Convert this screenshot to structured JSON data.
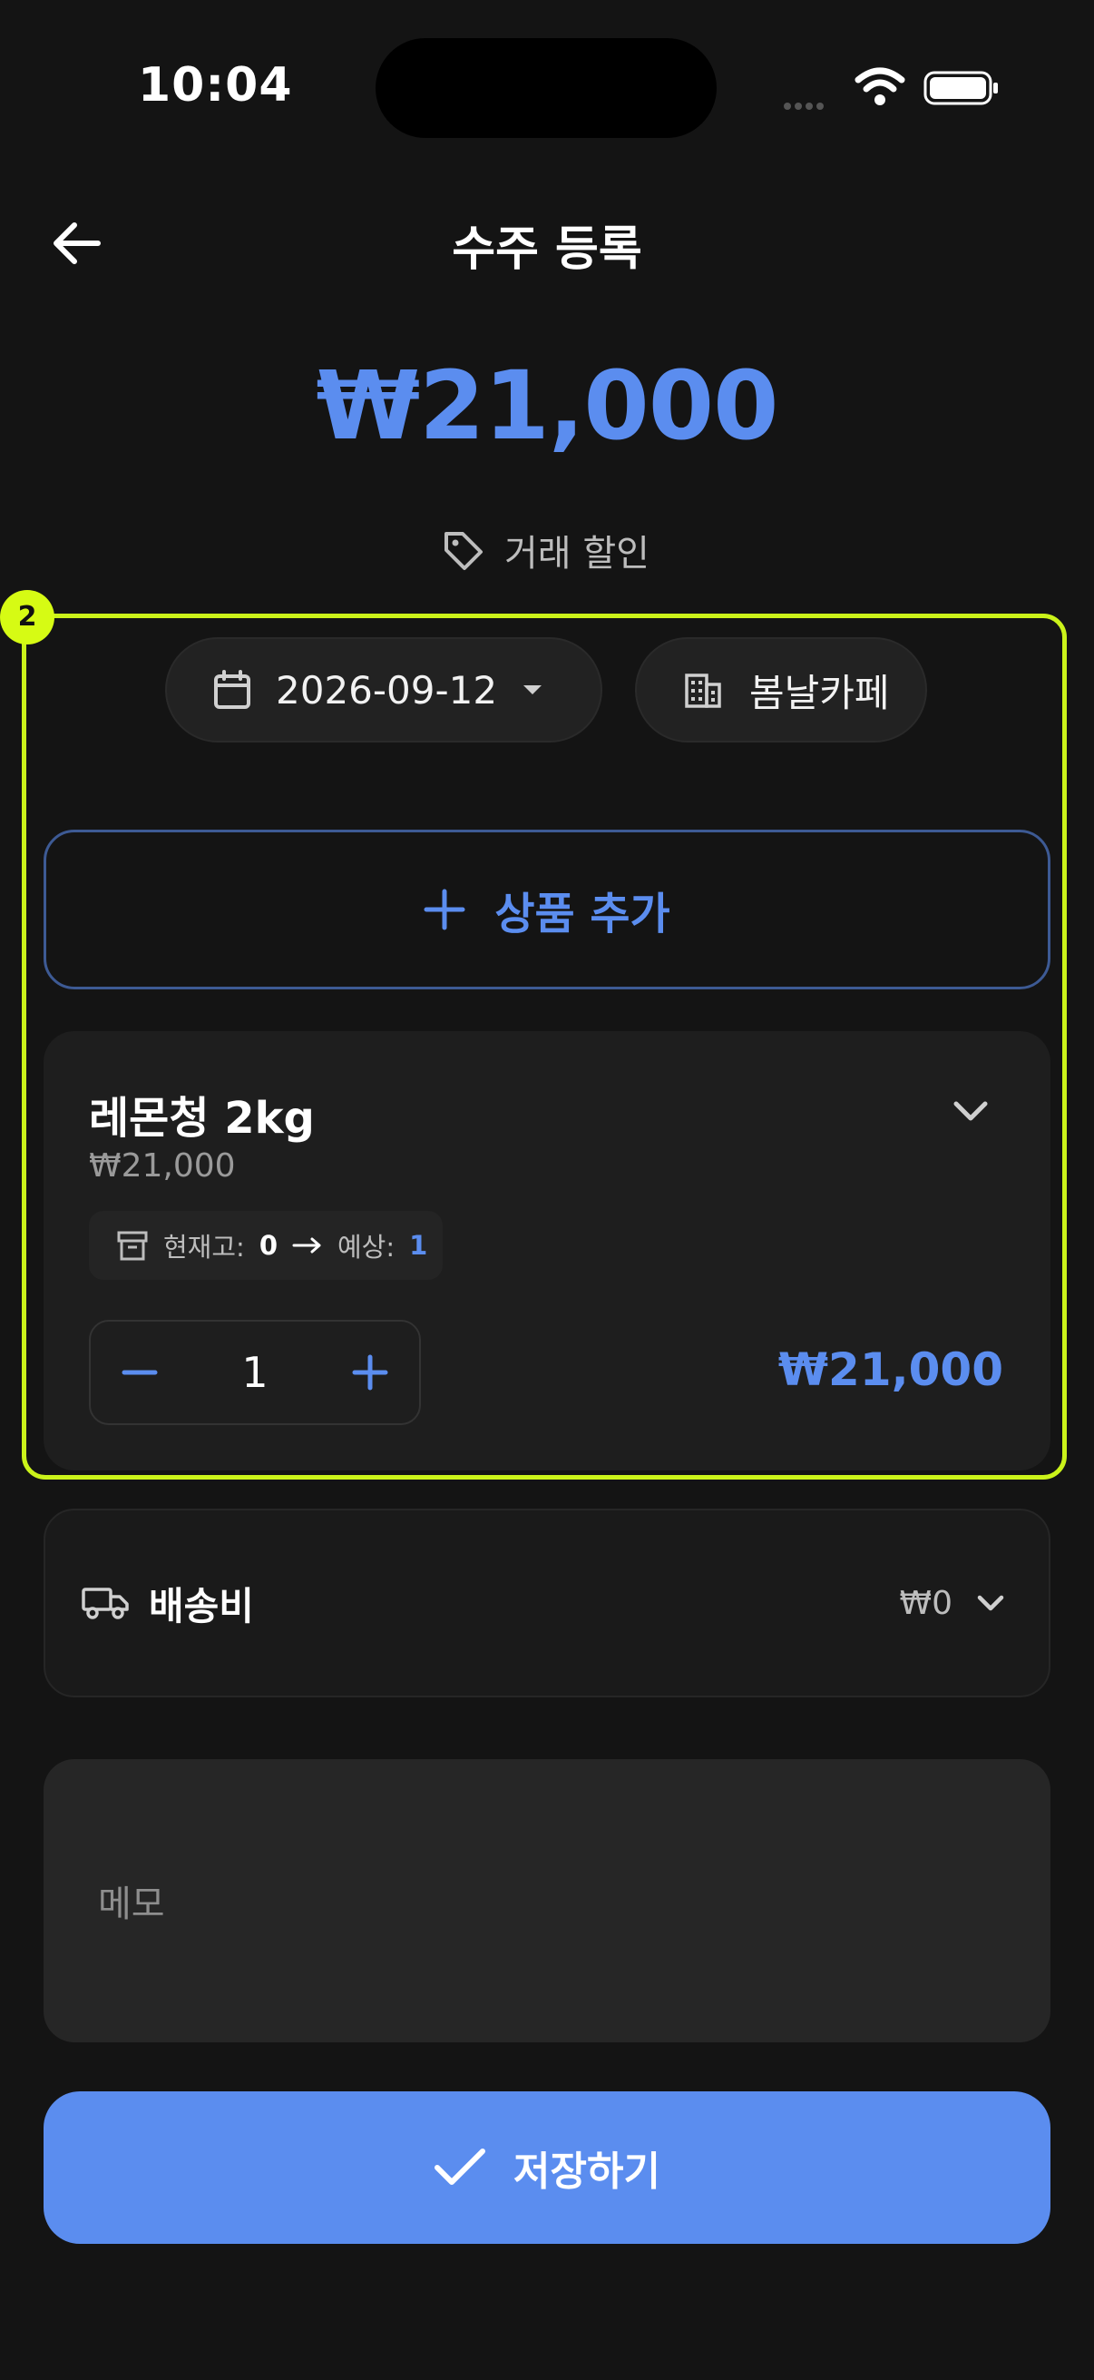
{
  "status_bar": {
    "time": "10:04"
  },
  "header": {
    "title": "수주 등록"
  },
  "summary": {
    "total": "₩21,000",
    "discount_label": "거래 할인"
  },
  "annotation": {
    "badge": "2"
  },
  "filters": {
    "date": "2026-09-12",
    "store": "봄날카페"
  },
  "add_product": {
    "label": "상품 추가"
  },
  "item": {
    "name": "레몬청 2kg",
    "unit_price": "₩21,000",
    "stock_label": "현재고:",
    "stock_value": "0",
    "expected_label": "예상:",
    "expected_value": "1",
    "quantity": "1",
    "line_total": "₩21,000"
  },
  "shipping": {
    "label": "배송비",
    "value": "₩0"
  },
  "memo": {
    "placeholder": "메모"
  },
  "save": {
    "label": "저장하기"
  },
  "colors": {
    "accent": "#5b8def",
    "highlight": "#cbf31a",
    "background": "#141414"
  },
  "icons": [
    "back-arrow-icon",
    "tag-icon",
    "calendar-icon",
    "dropdown-caret-icon",
    "building-icon",
    "plus-icon",
    "chevron-down-icon",
    "archive-icon",
    "arrow-right-icon",
    "minus-icon",
    "truck-icon",
    "check-icon"
  ]
}
